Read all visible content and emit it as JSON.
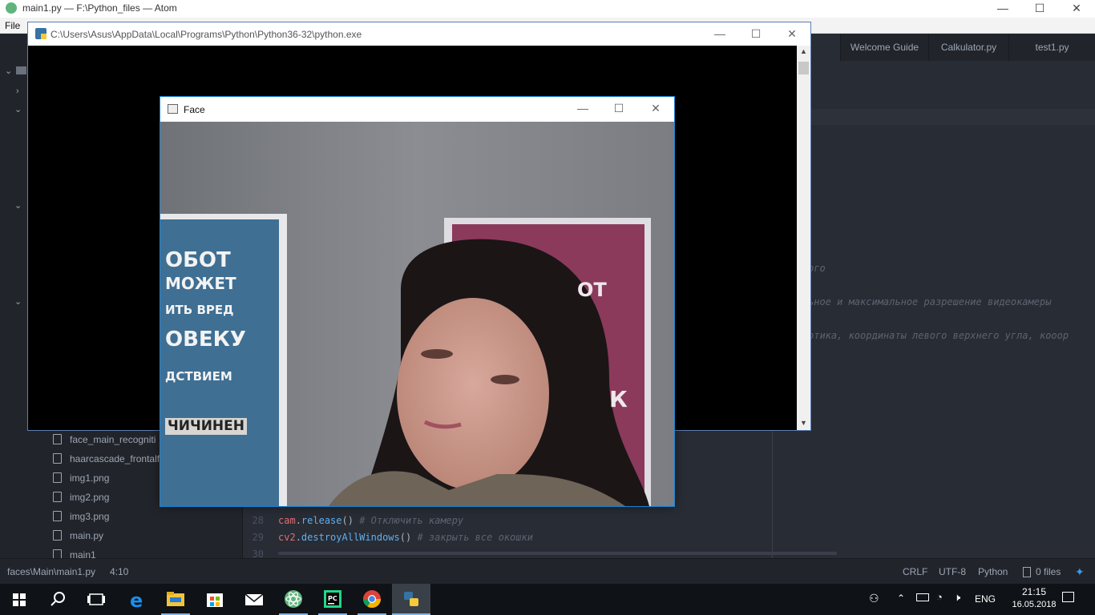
{
  "atom": {
    "title": "main1.py — F:\\Python_files — Atom",
    "menu_file": "File",
    "window_buttons": {
      "minimize": "—",
      "maximize": "☐",
      "close": "✕"
    },
    "tabs": [
      "Welcome Guide",
      "Calkulator.py",
      "test1.py"
    ],
    "tree_files": [
      "face_main_recogniti",
      "haarcascade_frontalfa",
      "img1.png",
      "img2.png",
      "img3.png",
      "main.py",
      "main1"
    ],
    "code_fragments": [
      "ого",
      "ьное и максимальное разрешение видеокамеры",
      "отика, координаты левого верхнего угла, кооор"
    ],
    "code_lines": [
      {
        "num": "28",
        "obj": "cam",
        "method": "release",
        "parens": "()",
        "comment": "# Отключить камеру"
      },
      {
        "num": "29",
        "obj": "cv2",
        "method": "destroyAllWindows",
        "parens": "()",
        "comment": "# закрыть все окошки"
      },
      {
        "num": "30"
      }
    ]
  },
  "status": {
    "path": "faces\\Main\\main1.py",
    "cursor": "4:10",
    "line_ending": "CRLF",
    "encoding": "UTF-8",
    "grammar": "Python",
    "files": "0 files"
  },
  "console_window": {
    "title": "C:\\Users\\Asus\\AppData\\Local\\Programs\\Python\\Python36-32\\python.exe"
  },
  "face_window": {
    "title": "Face",
    "poster_left_lines": [
      "ОБОТ",
      "МОЖЕТ",
      "ИТЬ ВРЕД",
      "ОВЕКУ",
      "ДСТВИЕМ",
      "ЧИЧИНЕН"
    ],
    "poster_right_lines": [
      "ОТ",
      "К"
    ]
  },
  "taskbar": {
    "lang": "ENG",
    "time": "21:15",
    "date": "16.05.2018"
  },
  "colors": {
    "atom_bg": "#282c34",
    "tree_bg": "#21252b",
    "accent_blue": "#1883d7",
    "code_red": "#e06c75",
    "code_blue": "#61afef"
  }
}
